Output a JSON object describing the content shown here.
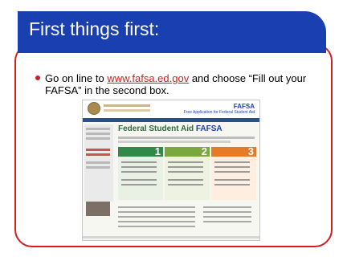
{
  "slide": {
    "title": "First things first:",
    "bullet": {
      "before_link": "Go on line to ",
      "link_text": "www.fafsa.ed.gov",
      "after_link": " and choose “Fill out your FAFSA”  in the second box."
    }
  },
  "screenshot": {
    "logo_text": "FAFSA",
    "logo_sub": "Free Application for Federal Student Aid",
    "heading_left": "Federal Student Aid",
    "heading_right": "FAFSA",
    "columns": [
      "1",
      "2",
      "3"
    ]
  },
  "colors": {
    "title_bar": "#1a3fb0",
    "frame_border": "#d21d24",
    "bullet": "#d21d24",
    "link": "#d21d24"
  }
}
